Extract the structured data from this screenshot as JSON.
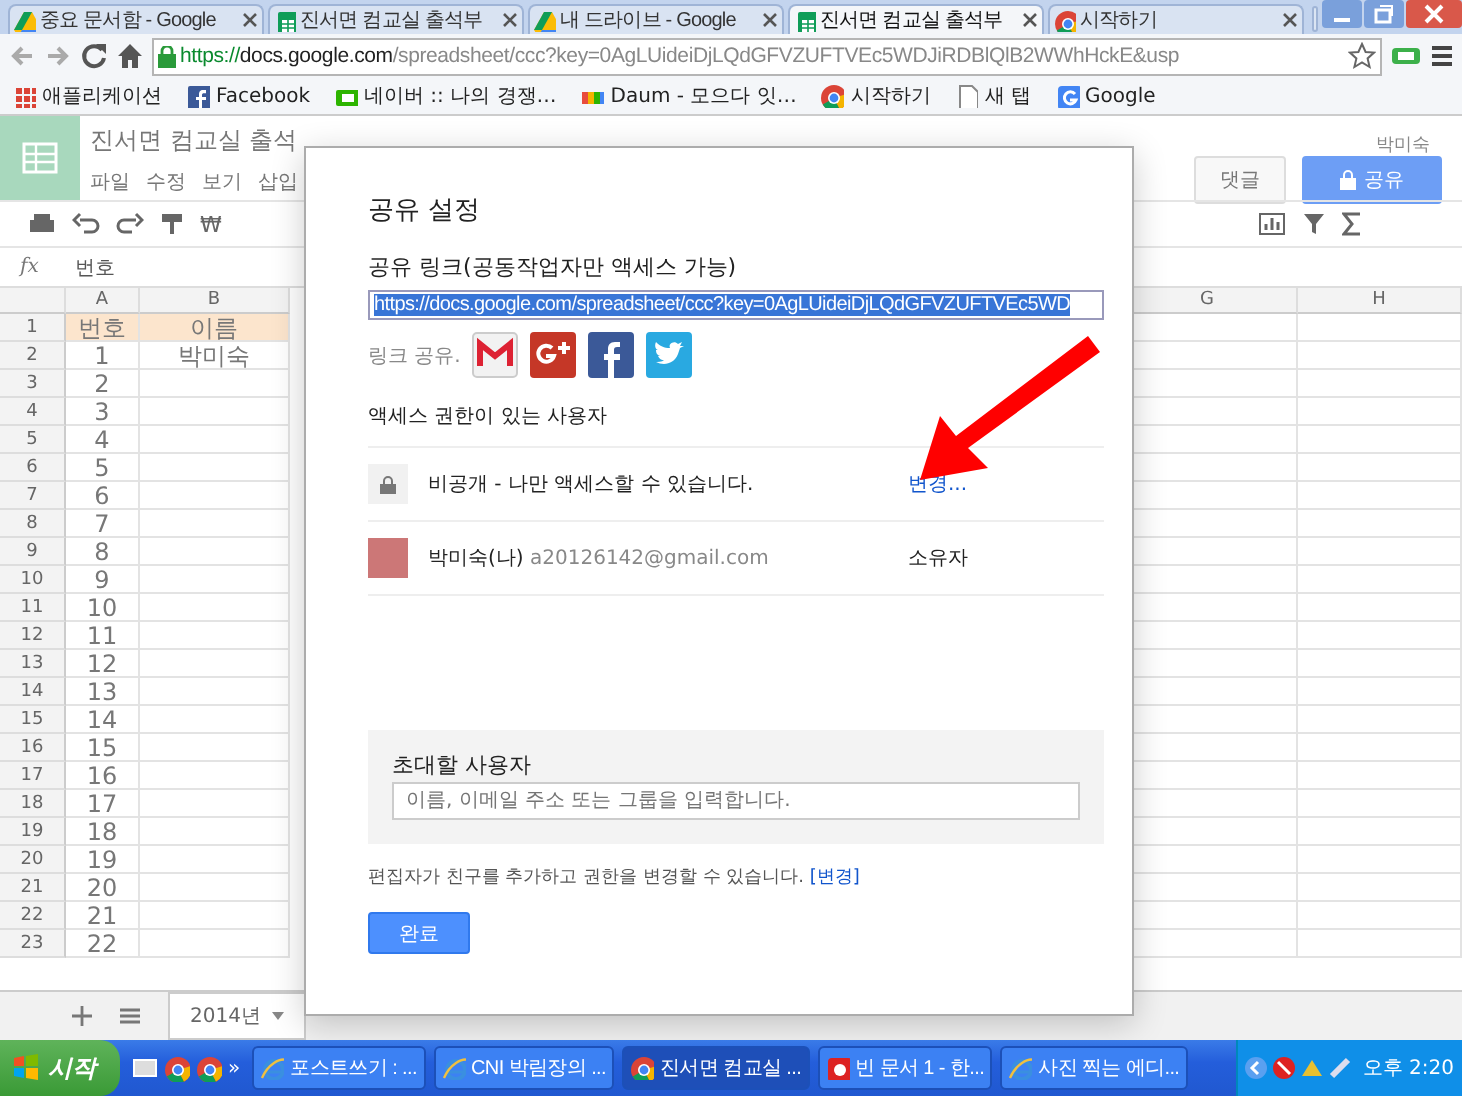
{
  "browser": {
    "tabs": [
      {
        "title": "중요 문서함 - Google",
        "kind": "drive",
        "selected": false
      },
      {
        "title": "진서면 컴교실 출석부",
        "kind": "sheets",
        "selected": false
      },
      {
        "title": "내 드라이브 - Google",
        "kind": "drive",
        "selected": false
      },
      {
        "title": "진서면 컴교실 출석부",
        "kind": "sheets",
        "selected": true
      },
      {
        "title": "시작하기",
        "kind": "chrome",
        "selected": false
      }
    ],
    "address": {
      "scheme": "https://",
      "host": "docs.google.com",
      "path": "/spreadsheet/ccc?key=0AgLUideiDjLQdGFVZUFTVEc5WDJiRDBlQlB2WWhHckE&usp"
    },
    "bookmarks": [
      {
        "label": "애플리케이션",
        "kind": "apps"
      },
      {
        "label": "Facebook",
        "kind": "facebook"
      },
      {
        "label": "네이버 :: 나의 경쟁…",
        "kind": "naver"
      },
      {
        "label": "Daum - 모으다 잇…",
        "kind": "daum"
      },
      {
        "label": "시작하기",
        "kind": "chrome"
      },
      {
        "label": "새 탭",
        "kind": "page"
      },
      {
        "label": "Google",
        "kind": "google"
      }
    ]
  },
  "spreadsheet": {
    "title": "진서면 컴교실 출석",
    "menu": [
      "파일",
      "수정",
      "보기",
      "삽입"
    ],
    "user": "박미숙",
    "currency": "₩",
    "buttons": [
      {
        "label": "댓글",
        "kind": "comment"
      },
      {
        "label": "공유",
        "kind": "share"
      }
    ],
    "formula": {
      "label": "fx",
      "value": "번호"
    },
    "columns": [
      "A",
      "B",
      "G",
      "H"
    ],
    "rows": [
      {
        "number": "1",
        "cells": [
          "번호",
          "이름"
        ],
        "header": true
      },
      {
        "number": "2",
        "cells": [
          "1",
          "박미숙"
        ],
        "header": false
      },
      {
        "number": "3",
        "cells": [
          "2"
        ],
        "header": false
      },
      {
        "number": "4",
        "cells": [
          "3"
        ],
        "header": false
      },
      {
        "number": "5",
        "cells": [
          "4"
        ],
        "header": false
      },
      {
        "number": "6",
        "cells": [
          "5"
        ],
        "header": false
      },
      {
        "number": "7",
        "cells": [
          "6"
        ],
        "header": false
      },
      {
        "number": "8",
        "cells": [
          "7"
        ],
        "header": false
      },
      {
        "number": "9",
        "cells": [
          "8"
        ],
        "header": false
      },
      {
        "number": "10",
        "cells": [
          "9"
        ],
        "header": false
      },
      {
        "number": "11",
        "cells": [
          "10"
        ],
        "header": false
      },
      {
        "number": "12",
        "cells": [
          "11"
        ],
        "header": false
      },
      {
        "number": "13",
        "cells": [
          "12"
        ],
        "header": false
      },
      {
        "number": "14",
        "cells": [
          "13"
        ],
        "header": false
      },
      {
        "number": "15",
        "cells": [
          "14"
        ],
        "header": false
      },
      {
        "number": "16",
        "cells": [
          "15"
        ],
        "header": false
      },
      {
        "number": "17",
        "cells": [
          "16"
        ],
        "header": false
      },
      {
        "number": "18",
        "cells": [
          "17"
        ],
        "header": false
      },
      {
        "number": "19",
        "cells": [
          "18"
        ],
        "header": false
      },
      {
        "number": "20",
        "cells": [
          "19"
        ],
        "header": false
      },
      {
        "number": "21",
        "cells": [
          "20"
        ],
        "header": false
      },
      {
        "number": "22",
        "cells": [
          "21"
        ],
        "header": false
      },
      {
        "number": "23",
        "cells": [
          "22"
        ],
        "header": false
      }
    ],
    "sheet_tab": "2014년"
  },
  "share_dialog": {
    "title": "공유 설정",
    "link_label": "공유 링크(공동작업자만 액세스 가능)",
    "link_value": "https://docs.google.com/spreadsheet/ccc?key=0AgLUideiDjLQdGFVZUFTVEc5WD",
    "share_label": "링크 공유.",
    "access_heading": "액세스 권한이 있는 사용자",
    "access_rows": [
      {
        "kind": "visibility",
        "text": "비공개 - 나만 액세스할 수 있습니다.",
        "action": "변경..."
      },
      {
        "kind": "person",
        "name": "박미숙(나)",
        "email": "a20126142@gmail.com",
        "role": "소유자"
      }
    ],
    "invite": {
      "label": "초대할 사용자",
      "placeholder": "이름, 이메일 주소 또는 그룹을 입력합니다."
    },
    "note": "편집자가 친구를 추가하고 권한을 변경할 수 있습니다.",
    "note_link": "[변경]",
    "done": "완료"
  },
  "taskbar": {
    "start": "시작",
    "more": "»",
    "tasks": [
      {
        "label": "포스트쓰기 : ...",
        "kind": "ie",
        "selected": false
      },
      {
        "label": "CNI 박림장의 ...",
        "kind": "ie",
        "selected": false
      },
      {
        "label": "진서면 컴교실 ...",
        "kind": "chrome",
        "selected": true
      },
      {
        "label": "빈 문서 1 - 한...",
        "kind": "hwp",
        "selected": false
      },
      {
        "label": "사진 찍는 에디...",
        "kind": "ie",
        "selected": false
      }
    ],
    "clock": "오후 2:20"
  }
}
